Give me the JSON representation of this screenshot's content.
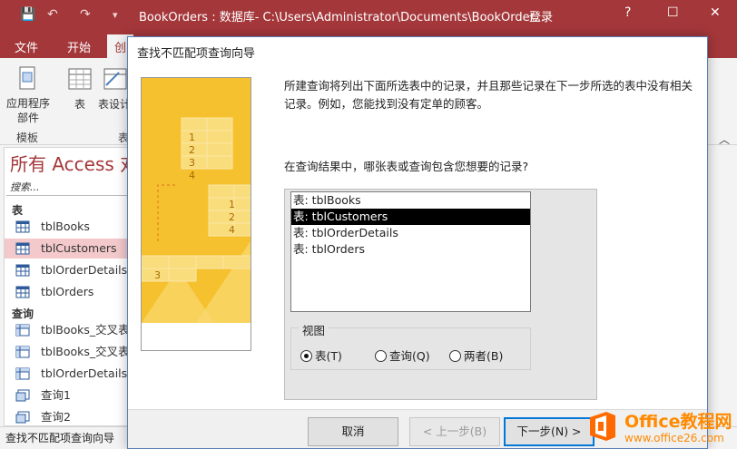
{
  "titlebar": {
    "title": "BookOrders : 数据库- C:\\Users\\Administrator\\Documents\\BookOrder...",
    "signin": "登录",
    "qa_save": "💾",
    "qa_undo": "↶",
    "qa_redo": "↷",
    "qa_more": "▾",
    "help": "?",
    "minimize": "—",
    "maximize": "☐",
    "close": "✕"
  },
  "ribbon": {
    "tabs": [
      "文件",
      "开始",
      "创"
    ],
    "app_parts": "应用程序\n部件",
    "app_parts_arrow": "▾",
    "table": "表",
    "table_design": "表设计",
    "group_templates": "模板",
    "group_tables": "表",
    "collapse": "︿"
  },
  "nav": {
    "title": "所有 Access 对",
    "search": "搜索...",
    "sections": {
      "tables": "表",
      "queries": "查询"
    },
    "tables": [
      "tblBooks",
      "tblCustomers",
      "tblOrderDetails",
      "tblOrders"
    ],
    "queries": [
      "tblBooks_交叉表",
      "tblBooks_交叉表",
      "tblOrderDetails_交",
      "查询1",
      "查询2"
    ]
  },
  "status": {
    "text": "查找不匹配项查询向导"
  },
  "dialog": {
    "title": "查找不匹配项查询向导",
    "description": "所建查询将列出下面所选表中的记录，并且那些记录在下一步所选的表中没有相关记录。例如，您能找到没有定单的顾客。",
    "prompt": "在查询结果中，哪张表或查询包含您想要的记录?",
    "list_items": [
      "表: tblBooks",
      "表: tblCustomers",
      "表: tblOrderDetails",
      "表: tblOrders"
    ],
    "selected_index": 1,
    "view_label": "视图",
    "radio_tables": "表(T)",
    "radio_queries": "查询(Q)",
    "radio_both": "两者(B)",
    "cancel": "取消",
    "back": "< 上一步(B)",
    "next": "下一步(N) >"
  },
  "illustration": {
    "numbers_top": [
      "1",
      "2",
      "3",
      "4"
    ],
    "numbers_right": [
      "1",
      "2",
      "4"
    ],
    "number_bottom": "3"
  },
  "watermark": {
    "brand": "Office教程网",
    "site": "www.office26.com"
  },
  "colors": {
    "accent": "#a4373a",
    "selection_nav": "#f3c9cb",
    "illustration": "#f6c12e",
    "watermark": "#ff8a00"
  }
}
